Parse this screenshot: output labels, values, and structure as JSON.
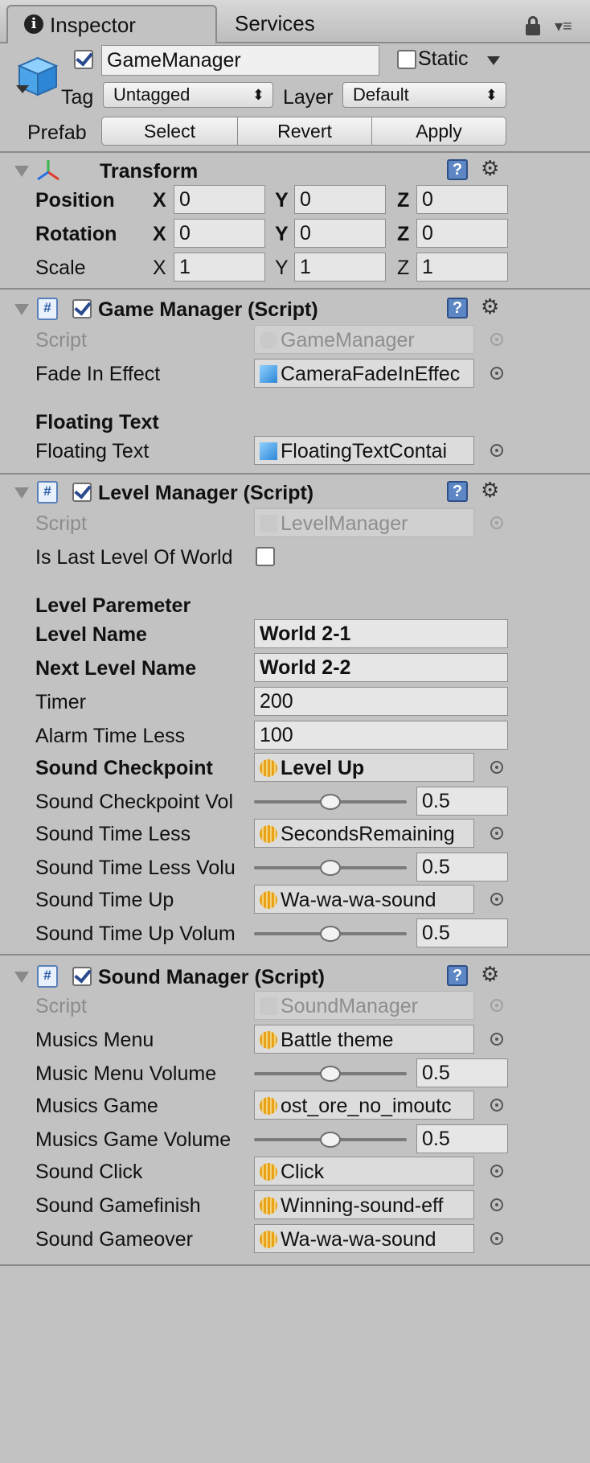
{
  "tabs": {
    "inspector": "Inspector",
    "services": "Services"
  },
  "object": {
    "name": "GameManager",
    "static_label": "Static",
    "tag_label": "Tag",
    "tag_value": "Untagged",
    "layer_label": "Layer",
    "layer_value": "Default"
  },
  "prefab": {
    "label": "Prefab",
    "select": "Select",
    "revert": "Revert",
    "apply": "Apply"
  },
  "transform": {
    "title": "Transform",
    "rows": [
      {
        "label": "Position",
        "x": "0",
        "y": "0",
        "z": "0"
      },
      {
        "label": "Rotation",
        "x": "0",
        "y": "0",
        "z": "0"
      },
      {
        "label": "Scale",
        "x": "1",
        "y": "1",
        "z": "1"
      }
    ],
    "axis_x": "X",
    "axis_y": "Y",
    "axis_z": "Z"
  },
  "game_manager": {
    "title": "Game Manager (Script)",
    "script_label": "Script",
    "script_value": "GameManager",
    "fade_label": "Fade In Effect",
    "fade_value": "CameraFadeInEffec",
    "floating_header": "Floating Text",
    "floating_label": "Floating Text",
    "floating_value": "FloatingTextContai"
  },
  "level_manager": {
    "title": "Level Manager (Script)",
    "script_label": "Script",
    "script_value": "LevelManager",
    "is_last_label": "Is Last Level Of World",
    "header": "Level Paremeter",
    "level_name_label": "Level Name",
    "level_name_value": "World 2-1",
    "next_level_label": "Next Level Name",
    "next_level_value": "World 2-2",
    "timer_label": "Timer",
    "timer_value": "200",
    "alarm_label": "Alarm Time Less",
    "alarm_value": "100",
    "sound_checkpoint_label": "Sound Checkpoint",
    "sound_checkpoint_value": "Level Up",
    "sound_checkpoint_vol_label": "Sound Checkpoint Vol",
    "sound_checkpoint_vol_value": "0.5",
    "sound_time_less_label": "Sound Time Less",
    "sound_time_less_value": "SecondsRemaining",
    "sound_time_less_vol_label": "Sound Time Less Volu",
    "sound_time_less_vol_value": "0.5",
    "sound_time_up_label": "Sound Time Up",
    "sound_time_up_value": "Wa-wa-wa-sound",
    "sound_time_up_vol_label": "Sound Time Up Volum",
    "sound_time_up_vol_value": "0.5"
  },
  "sound_manager": {
    "title": "Sound Manager (Script)",
    "script_label": "Script",
    "script_value": "SoundManager",
    "musics_menu_label": "Musics Menu",
    "musics_menu_value": "Battle theme",
    "music_menu_vol_label": "Music Menu Volume",
    "music_menu_vol_value": "0.5",
    "musics_game_label": "Musics Game",
    "musics_game_value": "ost_ore_no_imoutc",
    "musics_game_vol_label": "Musics Game Volume",
    "musics_game_vol_value": "0.5",
    "sound_click_label": "Sound Click",
    "sound_click_value": "Click",
    "sound_gamefinish_label": "Sound Gamefinish",
    "sound_gamefinish_value": "Winning-sound-eff",
    "sound_gameover_label": "Sound Gameover",
    "sound_gameover_value": "Wa-wa-wa-sound"
  }
}
